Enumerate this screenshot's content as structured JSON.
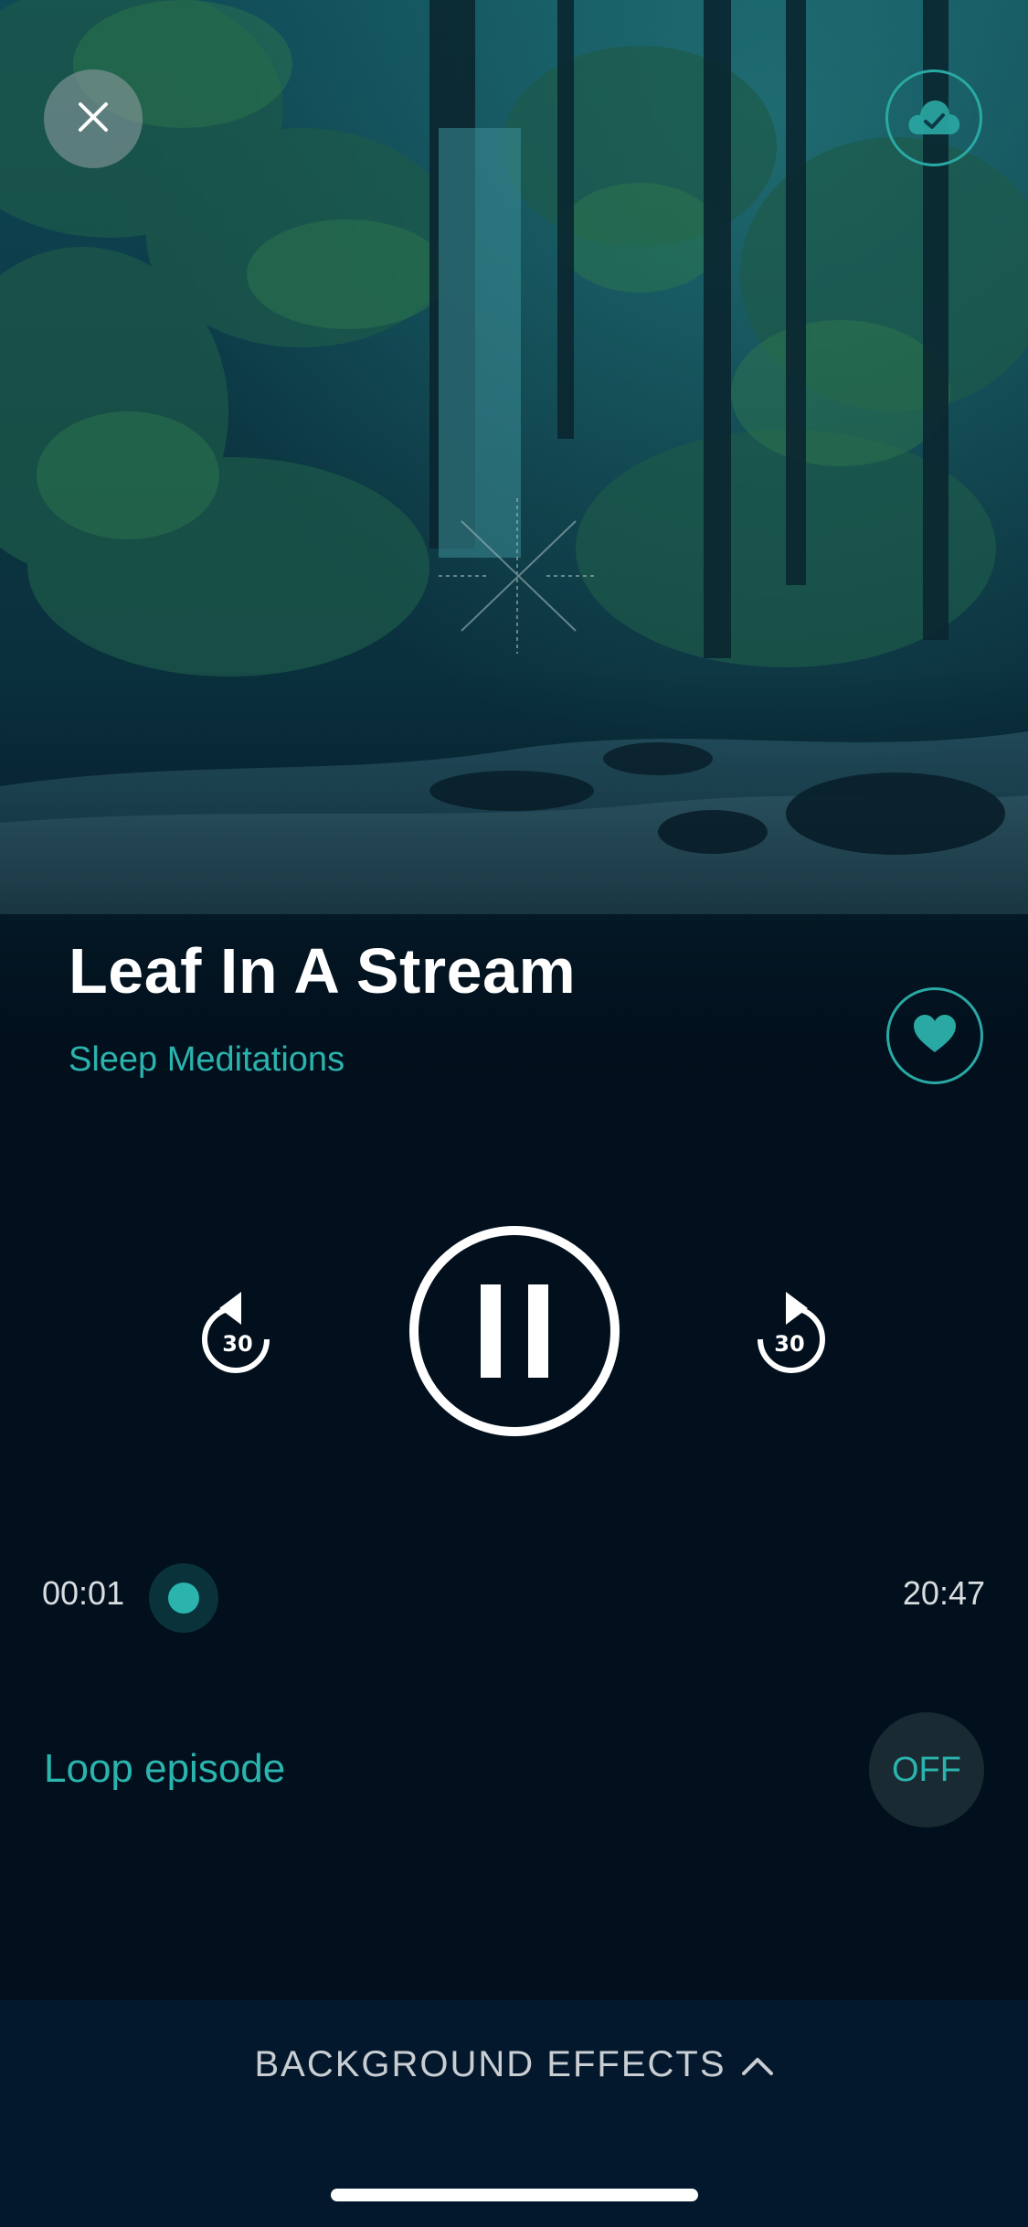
{
  "player": {
    "title": "Leaf In A Stream",
    "subtitle": "Sleep Meditations",
    "rewind_seconds": "30",
    "forward_seconds": "30",
    "elapsed": "00:01",
    "total": "20:47",
    "progress_fraction": 0.0008
  },
  "loop": {
    "label": "Loop episode",
    "state": "OFF"
  },
  "bottom": {
    "background_effects_label": "BACKGROUND EFFECTS"
  },
  "icons": {
    "close": "close-icon",
    "cloud": "cloud-check-icon",
    "heart": "heart-icon",
    "rewind": "rewind-30-icon",
    "forward": "forward-30-icon",
    "pause": "pause-icon",
    "chevron": "chevron-up-icon"
  },
  "colors": {
    "accent": "#2bb3ad",
    "background": "#020f1c",
    "bottom_bar": "#03182c"
  }
}
